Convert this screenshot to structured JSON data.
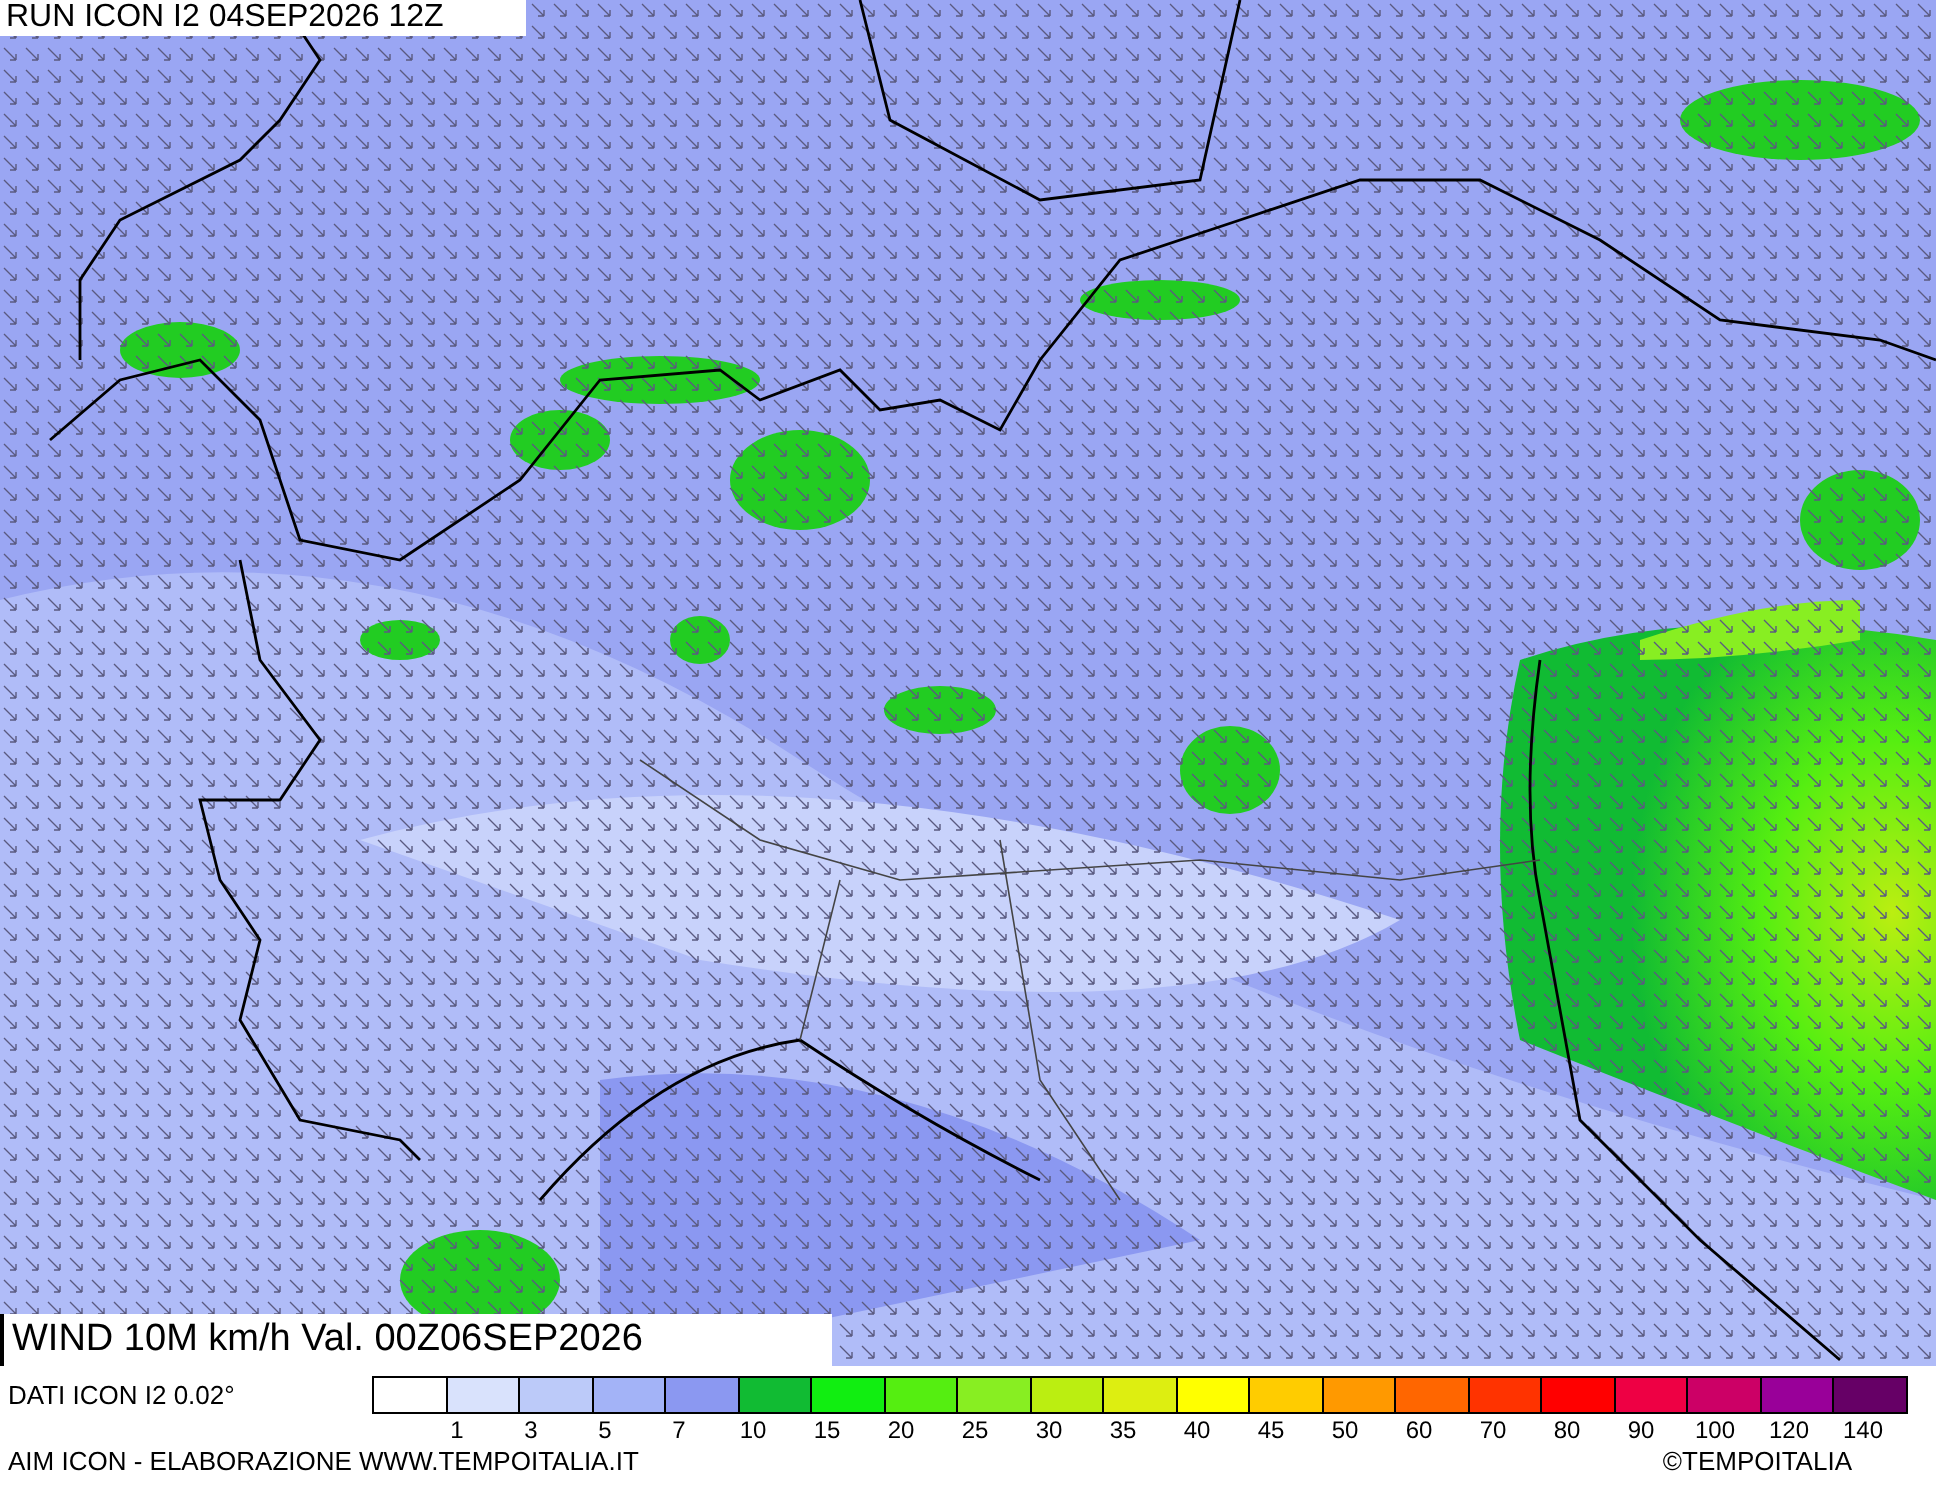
{
  "run_title": "RUN ICON I2 04SEP2026 12Z",
  "map_title": "WIND 10M km/h Val. 00Z06SEP2026",
  "data_source": "DATI ICON I2 0.02°",
  "legend": {
    "bins": [
      {
        "color": "#ffffff"
      },
      {
        "color": "#d9e2fc"
      },
      {
        "color": "#bccaf9"
      },
      {
        "color": "#a3b3f7"
      },
      {
        "color": "#8b98f1"
      },
      {
        "color": "#11bb33"
      },
      {
        "color": "#11ee11"
      },
      {
        "color": "#55ee11"
      },
      {
        "color": "#88ee22"
      },
      {
        "color": "#bbee11"
      },
      {
        "color": "#ddee11"
      },
      {
        "color": "#ffff00"
      },
      {
        "color": "#ffcc00"
      },
      {
        "color": "#ff9900"
      },
      {
        "color": "#ff6600"
      },
      {
        "color": "#ff3300"
      },
      {
        "color": "#ff0000"
      },
      {
        "color": "#ee0044"
      },
      {
        "color": "#cc0066"
      },
      {
        "color": "#990099"
      },
      {
        "color": "#660066"
      }
    ],
    "ticks": [
      "1",
      "3",
      "5",
      "7",
      "10",
      "15",
      "20",
      "25",
      "30",
      "35",
      "40",
      "45",
      "50",
      "60",
      "70",
      "80",
      "90",
      "100",
      "120",
      "140"
    ]
  },
  "credit": "AIM ICON - ELABORAZIONE WWW.TEMPOITALIA.IT",
  "copyright": "©TEMPOITALIA"
}
